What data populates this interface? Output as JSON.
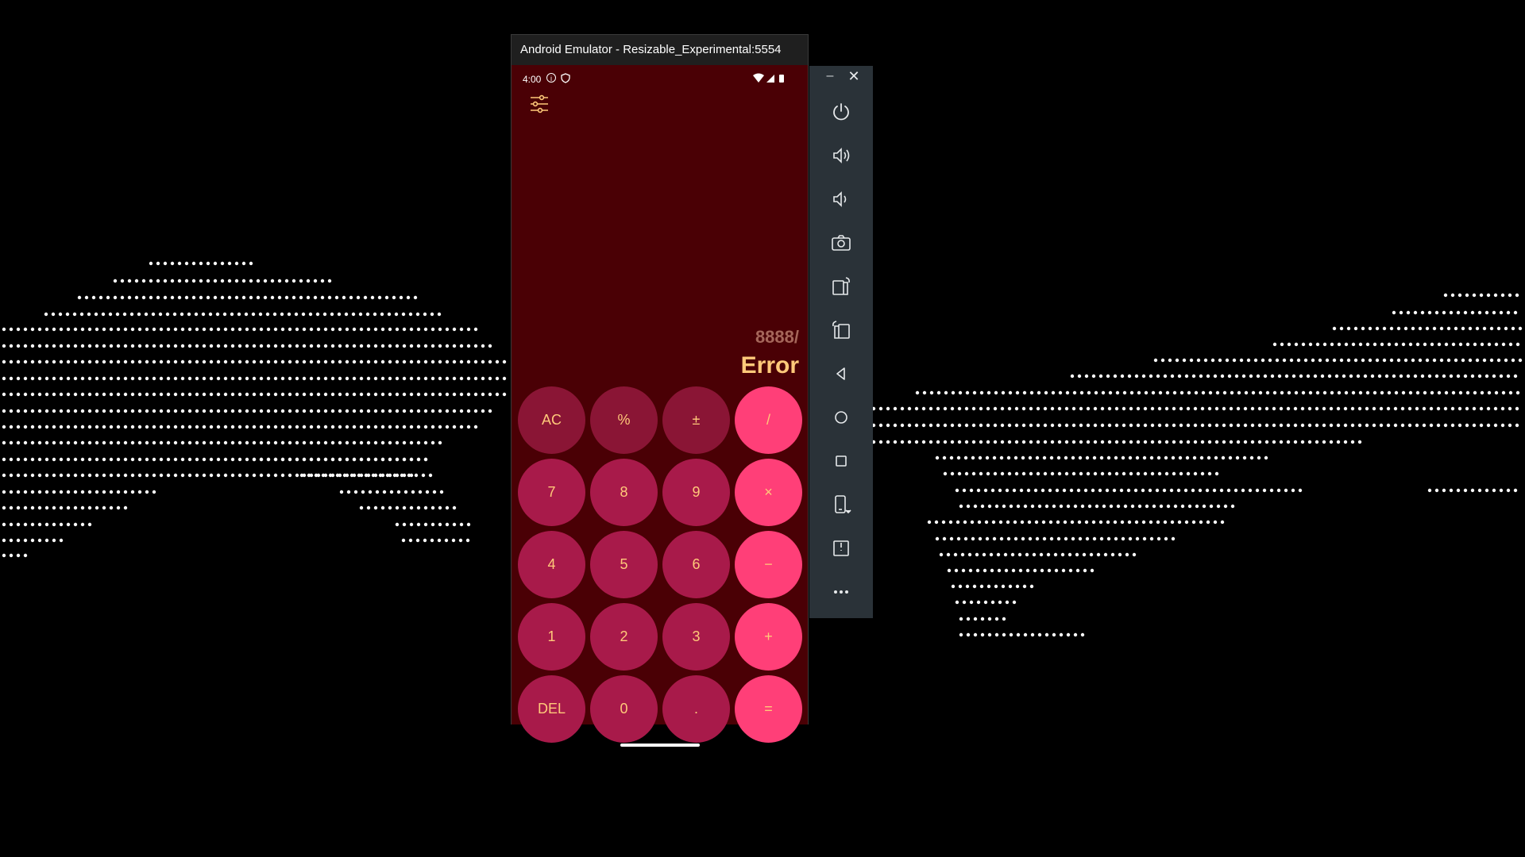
{
  "window": {
    "title": "Android Emulator - Resizable_Experimental:5554"
  },
  "statusbar": {
    "time": "4:00",
    "info_icon": "info-icon",
    "shield_icon": "shield-icon"
  },
  "display": {
    "expression": "8888/",
    "result": "Error"
  },
  "keypad": {
    "rows": [
      [
        "AC",
        "%",
        "±",
        "/"
      ],
      [
        "7",
        "8",
        "9",
        "×"
      ],
      [
        "4",
        "5",
        "6",
        "−"
      ],
      [
        "1",
        "2",
        "3",
        "+"
      ],
      [
        "DEL",
        "0",
        ".",
        "="
      ]
    ]
  },
  "toolbar": {
    "minimize": "–",
    "close": "✕",
    "buttons": [
      "power",
      "volume-up",
      "volume-down",
      "camera",
      "rotate-left",
      "rotate-right",
      "back",
      "home",
      "overview",
      "fold",
      "split",
      "more"
    ]
  },
  "colors": {
    "app_background": "#4a0005",
    "function_key": "#8a1535",
    "number_key": "#a81a4a",
    "operator_key": "#ff3f78",
    "key_text": "#ffc97a",
    "expression_text": "#a5665a",
    "toolbar_background": "#2a3238"
  }
}
